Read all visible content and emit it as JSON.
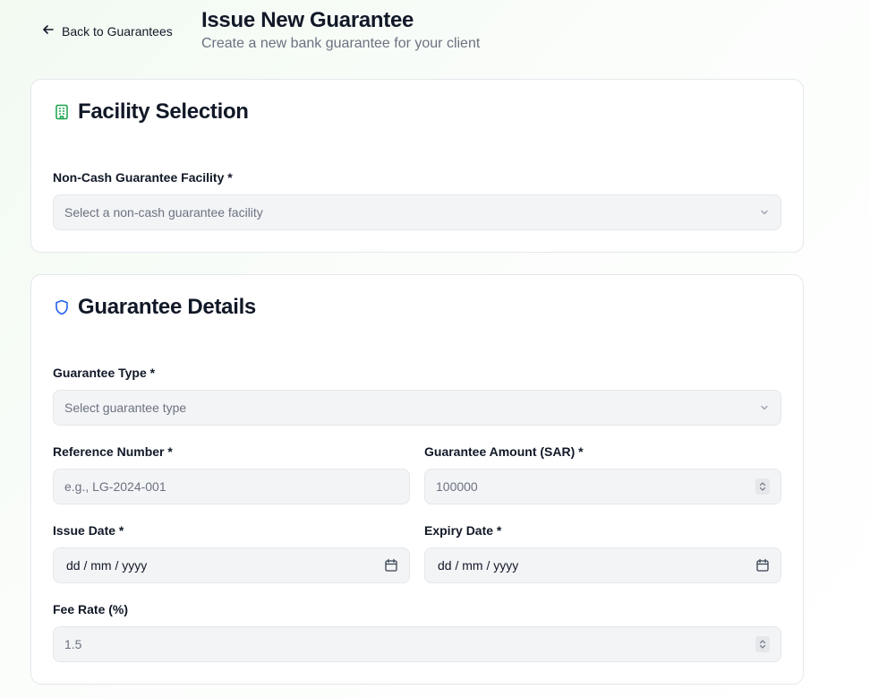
{
  "header": {
    "back_label": "Back to Guarantees",
    "title": "Issue New Guarantee",
    "subtitle": "Create a new bank guarantee for your client"
  },
  "facility_section": {
    "title": "Facility Selection",
    "icon": "building-icon",
    "facility_label": "Non-Cash Guarantee Facility *",
    "facility_placeholder": "Select a non-cash guarantee facility"
  },
  "details_section": {
    "title": "Guarantee Details",
    "icon": "shield-icon",
    "type_label": "Guarantee Type *",
    "type_placeholder": "Select guarantee type",
    "reference_label": "Reference Number *",
    "reference_placeholder": "e.g., LG-2024-001",
    "amount_label": "Guarantee Amount (SAR) *",
    "amount_placeholder": "100000",
    "issue_date_label": "Issue Date *",
    "issue_date_placeholder": "dd / mm / yyyy",
    "expiry_date_label": "Expiry Date *",
    "expiry_date_placeholder": "dd / mm / yyyy",
    "fee_rate_label": "Fee Rate (%)",
    "fee_rate_placeholder": "1.5"
  },
  "colors": {
    "facility_icon": "#16a34a",
    "details_icon": "#2563eb",
    "input_bg": "#f3f4f6",
    "border": "#e5e7eb"
  }
}
